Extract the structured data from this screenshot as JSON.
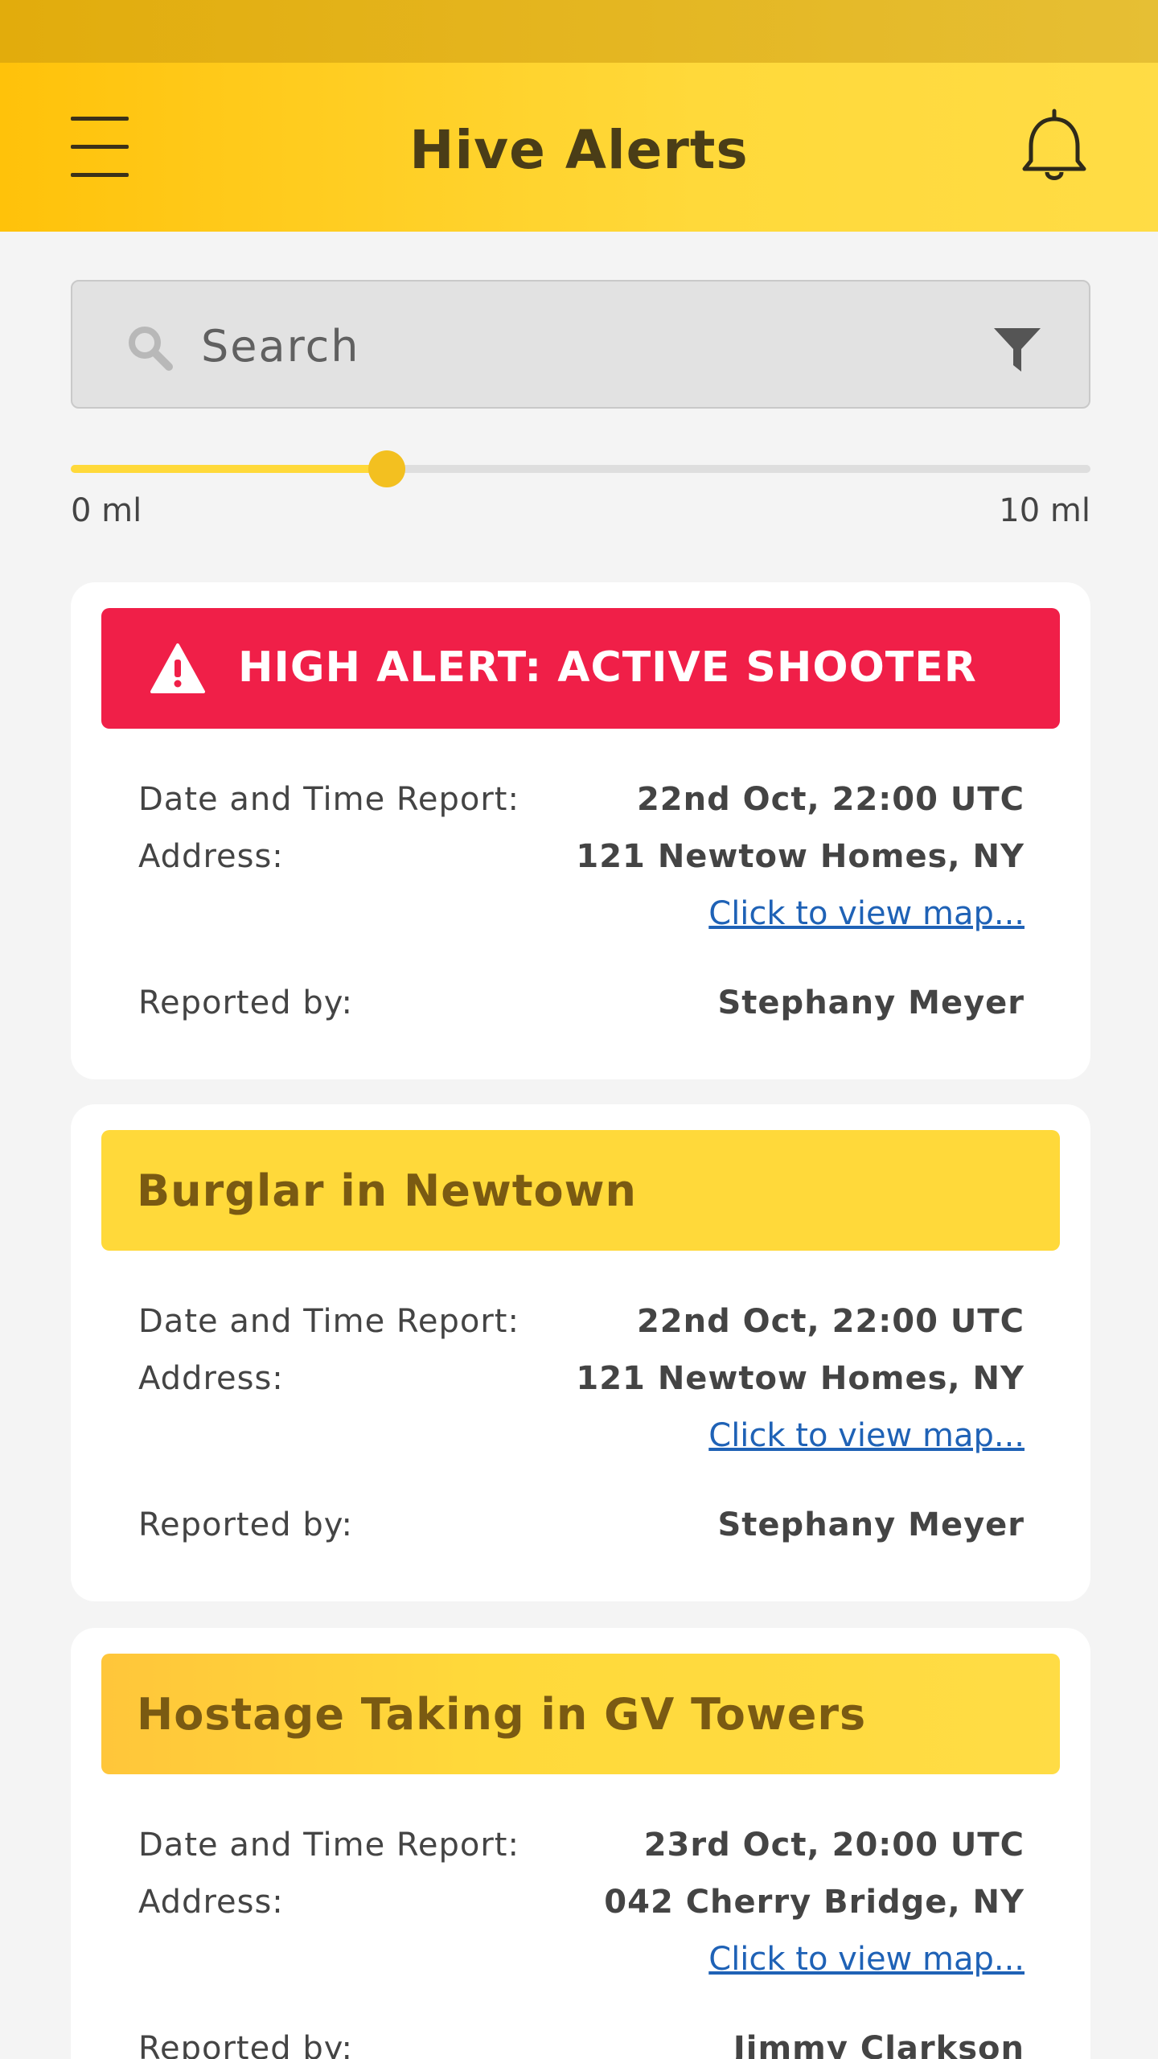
{
  "app": {
    "title": "Hive Alerts",
    "icons": {
      "menu": "hamburger-menu-icon",
      "notifications": "bell-icon",
      "search": "search-icon",
      "filter": "filter-icon",
      "warning": "warning-icon"
    }
  },
  "search": {
    "placeholder": "Search",
    "value": ""
  },
  "distance_slider": {
    "min_label": "0 ml",
    "max_label": "10 ml",
    "min": 0,
    "max": 10,
    "value": 3.1
  },
  "colors": {
    "accent": "#ffd93a",
    "high_alert": "#f01f48",
    "link": "#1f62b6"
  },
  "alerts": [
    {
      "title": "HIGH ALERT: ACTIVE SHOOTER",
      "severity": "high",
      "date_label": "Date and Time Report:",
      "date_value": "22nd Oct, 22:00 UTC",
      "address_label": "Address:",
      "address_value": "121 Newtow Homes, NY",
      "map_link": "Click to view map...",
      "reporter_label": "Reported by:",
      "reporter_value": "Stephany Meyer"
    },
    {
      "title": "Burglar in Newtown",
      "severity": "medium",
      "date_label": "Date and Time Report:",
      "date_value": "22nd Oct, 22:00 UTC",
      "address_label": "Address:",
      "address_value": "121 Newtow Homes, NY",
      "map_link": "Click to view map...",
      "reporter_label": "Reported by:",
      "reporter_value": "Stephany Meyer"
    },
    {
      "title": "Hostage Taking in GV Towers",
      "severity": "medium",
      "date_label": "Date and Time Report:",
      "date_value": "23rd Oct, 20:00 UTC",
      "address_label": "Address:",
      "address_value": "042 Cherry Bridge, NY",
      "map_link": "Click to view map...",
      "reporter_label": "Reported by:",
      "reporter_value": "Jimmy Clarkson"
    }
  ]
}
